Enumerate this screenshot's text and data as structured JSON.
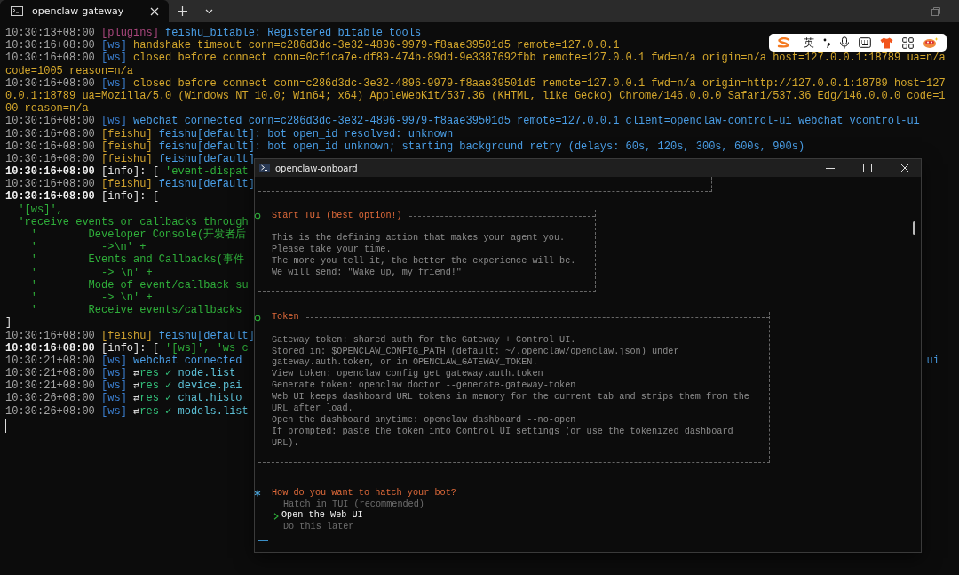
{
  "tabs": [
    {
      "title": "openclaw-gateway",
      "selected": true
    }
  ],
  "terminal": {
    "lines": [
      {
        "parts": [
          {
            "kind": "time",
            "text": "10:30:13+08:00 "
          },
          {
            "kind": "plugins",
            "text": "[plugins] "
          },
          {
            "kind": "blue",
            "text": "feishu_bitable: Registered bitable tools"
          }
        ]
      },
      {
        "parts": [
          {
            "kind": "time",
            "text": "10:30:16+08:00 "
          },
          {
            "kind": "ws",
            "text": "[ws] "
          },
          {
            "kind": "yellow",
            "text": "handshake timeout conn=c286d3dc-3e32-4896-9979-f8aae39501d5 remote=127.0.0.1"
          }
        ]
      },
      {
        "parts": [
          {
            "kind": "time",
            "text": "10:30:16+08:00 "
          },
          {
            "kind": "ws",
            "text": "[ws] "
          },
          {
            "kind": "yellow",
            "text": "closed before connect conn=0cf1ca7e-df89-474b-89dd-9e3387692fbb remote=127.0.0.1 fwd=n/a origin=n/a host=127.0.0.1:18789 ua=n/a"
          }
        ]
      },
      {
        "parts": [
          {
            "kind": "yellow",
            "text": "code=1005 reason=n/a"
          }
        ]
      },
      {
        "parts": [
          {
            "kind": "time",
            "text": "10:30:16+08:00 "
          },
          {
            "kind": "ws",
            "text": "[ws] "
          },
          {
            "kind": "yellow",
            "text": "closed before connect conn=c286d3dc-3e32-4896-9979-f8aae39501d5 remote=127.0.0.1 fwd=n/a origin=http://127.0.0.1:18789 host=127"
          }
        ]
      },
      {
        "parts": [
          {
            "kind": "yellow",
            "text": "0.0.1:18789 ua=Mozilla/5.0 (Windows NT 10.0; Win64; x64) AppleWebKit/537.36 (KHTML, like Gecko) Chrome/146.0.0.0 Safari/537.36 Edg/146.0.0.0 code=1"
          }
        ]
      },
      {
        "parts": [
          {
            "kind": "yellow",
            "text": "00 reason=n/a"
          }
        ]
      },
      {
        "parts": [
          {
            "kind": "time",
            "text": "10:30:16+08:00 "
          },
          {
            "kind": "ws",
            "text": "[ws] "
          },
          {
            "kind": "blue",
            "text": "webchat connected conn=c286d3dc-3e32-4896-9979-f8aae39501d5 remote=127.0.0.1 client=openclaw-control-ui webchat vcontrol-ui"
          }
        ]
      },
      {
        "parts": [
          {
            "kind": "time",
            "text": "10:30:16+08:00 "
          },
          {
            "kind": "feishu",
            "text": "[feishu] "
          },
          {
            "kind": "blue",
            "text": "feishu[default]: bot open_id resolved: unknown"
          }
        ]
      },
      {
        "parts": [
          {
            "kind": "time",
            "text": "10:30:16+08:00 "
          },
          {
            "kind": "feishu",
            "text": "[feishu] "
          },
          {
            "kind": "blue",
            "text": "feishu[default]: bot open_id unknown; starting background retry (delays: 60s, 120s, 300s, 600s, 900s)"
          }
        ]
      },
      {
        "parts": [
          {
            "kind": "time",
            "text": "10:30:16+08:00 "
          },
          {
            "kind": "feishu",
            "text": "[feishu] "
          },
          {
            "kind": "blue",
            "text": "feishu[default]"
          }
        ]
      },
      {
        "parts": [
          {
            "kind": "bright",
            "text": "10:30:16+08:00 "
          },
          {
            "kind": "white",
            "text": "[info]: [ "
          },
          {
            "kind": "green",
            "text": "'event-dispat"
          }
        ]
      },
      {
        "parts": [
          {
            "kind": "time",
            "text": "10:30:16+08:00 "
          },
          {
            "kind": "feishu",
            "text": "[feishu] "
          },
          {
            "kind": "blue",
            "text": "feishu[default]"
          }
        ]
      },
      {
        "parts": [
          {
            "kind": "bright",
            "text": "10:30:16+08:00 "
          },
          {
            "kind": "white",
            "text": "[info]: ["
          }
        ]
      },
      {
        "parts": [
          {
            "kind": "green",
            "text": "  '[ws]',"
          }
        ]
      },
      {
        "parts": [
          {
            "kind": "green",
            "text": "  'receive events or callbacks through"
          }
        ]
      },
      {
        "parts": [
          {
            "kind": "green",
            "text": "    '        Developer Console(开发者后"
          }
        ]
      },
      {
        "parts": [
          {
            "kind": "green",
            "text": "    '          ->\\n' +"
          }
        ]
      },
      {
        "parts": [
          {
            "kind": "green",
            "text": "    '        Events and Callbacks(事件"
          }
        ]
      },
      {
        "parts": [
          {
            "kind": "green",
            "text": "    '          -> \\n' +"
          }
        ]
      },
      {
        "parts": [
          {
            "kind": "green",
            "text": "    '        Mode of event/callback su"
          }
        ]
      },
      {
        "parts": [
          {
            "kind": "green",
            "text": "    '          -> \\n' +"
          }
        ]
      },
      {
        "parts": [
          {
            "kind": "green",
            "text": "    '        Receive events/callbacks"
          }
        ]
      },
      {
        "parts": [
          {
            "kind": "white",
            "text": "]"
          }
        ]
      },
      {
        "parts": [
          {
            "kind": "time",
            "text": "10:30:16+08:00 "
          },
          {
            "kind": "feishu",
            "text": "[feishu] "
          },
          {
            "kind": "blue",
            "text": "feishu[default]"
          }
        ]
      },
      {
        "parts": [
          {
            "kind": "bright",
            "text": "10:30:16+08:00 "
          },
          {
            "kind": "white",
            "text": "[info]: [ "
          },
          {
            "kind": "green",
            "text": "'[ws]', 'ws c"
          }
        ]
      },
      {
        "parts": [
          {
            "kind": "time",
            "text": "10:30:21+08:00 "
          },
          {
            "kind": "ws",
            "text": "[ws] "
          },
          {
            "kind": "blue",
            "text": "webchat connected"
          }
        ],
        "right": {
          "kind": "blue",
          "text": "ui"
        }
      },
      {
        "parts": [
          {
            "kind": "time",
            "text": "10:30:21+08:00 "
          },
          {
            "kind": "ws",
            "text": "[ws] "
          },
          {
            "kind": "arrow",
            "text": "⇄"
          },
          {
            "kind": "res",
            "text": "res ✓ "
          },
          {
            "kind": "cyan",
            "text": "node.list"
          }
        ]
      },
      {
        "parts": [
          {
            "kind": "time",
            "text": "10:30:21+08:00 "
          },
          {
            "kind": "ws",
            "text": "[ws] "
          },
          {
            "kind": "arrow",
            "text": "⇄"
          },
          {
            "kind": "res",
            "text": "res ✓ "
          },
          {
            "kind": "cyan",
            "text": "device.pai"
          }
        ]
      },
      {
        "parts": [
          {
            "kind": "time",
            "text": "10:30:26+08:00 "
          },
          {
            "kind": "ws",
            "text": "[ws] "
          },
          {
            "kind": "arrow",
            "text": "⇄"
          },
          {
            "kind": "res",
            "text": "res ✓ "
          },
          {
            "kind": "cyan",
            "text": "chat.histo"
          }
        ]
      },
      {
        "parts": [
          {
            "kind": "time",
            "text": "10:30:26+08:00 "
          },
          {
            "kind": "ws",
            "text": "[ws] "
          },
          {
            "kind": "arrow",
            "text": "⇄"
          },
          {
            "kind": "res",
            "text": "res ✓ "
          },
          {
            "kind": "cyan",
            "text": "models.list"
          }
        ]
      }
    ]
  },
  "ime_toolbar": {
    "language": "英"
  },
  "onboard_window": {
    "title": "openclaw-onboard",
    "sections": [
      {
        "title": "Start TUI (best option!)",
        "lines": [
          "This is the defining action that makes your agent you.",
          "Please take your time.",
          "The more you tell it, the better the experience will be.",
          "We will send: \"Wake up, my friend!\""
        ]
      },
      {
        "title": "Token",
        "lines": [
          "Gateway token: shared auth for the Gateway + Control UI.",
          "Stored in: $OPENCLAW_CONFIG_PATH (default: ~/.openclaw/openclaw.json) under",
          "gateway.auth.token, or in OPENCLAW_GATEWAY_TOKEN.",
          "View token: openclaw config get gateway.auth.token",
          "Generate token: openclaw doctor --generate-gateway-token",
          "Web UI keeps dashboard URL tokens in memory for the current tab and strips them from the",
          "URL after load.",
          "Open the dashboard anytime: openclaw dashboard --no-open",
          "If prompted: paste the token into Control UI settings (or use the tokenized dashboard",
          "URL)."
        ]
      }
    ],
    "prompt": {
      "question": "How do you want to hatch your bot?",
      "options": [
        {
          "label": "Hatch in TUI (recommended)",
          "selected": false
        },
        {
          "label": "Open the Web UI",
          "selected": true
        },
        {
          "label": "Do this later",
          "selected": false
        }
      ]
    }
  }
}
